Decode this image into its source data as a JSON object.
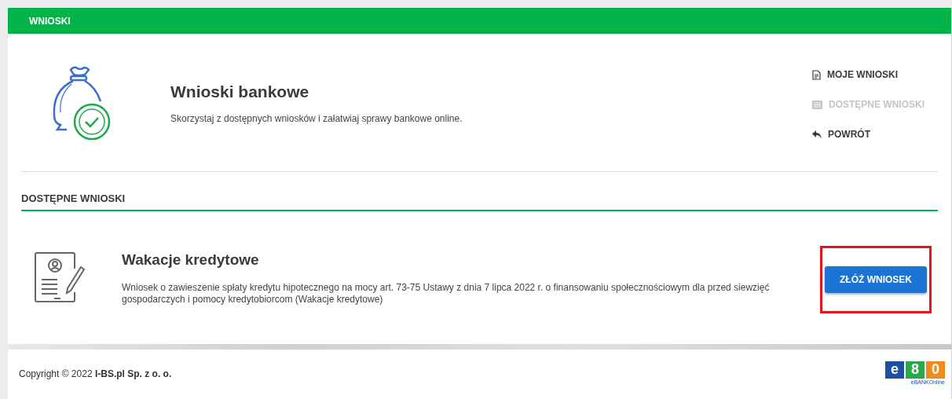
{
  "header": {
    "title": "WNIOSKI"
  },
  "intro": {
    "title": "Wnioski bankowe",
    "description": "Skorzystaj z dostępnych wniosków i załatwiaj sprawy bankowe online."
  },
  "nav": [
    {
      "kind": "document",
      "label": "MOJE WNIOSKI",
      "disabled": false
    },
    {
      "kind": "list",
      "label": "DOSTĘPNE WNIOSKI",
      "disabled": true
    },
    {
      "kind": "back",
      "label": "POWRÓT",
      "disabled": false
    }
  ],
  "section": {
    "title": "DOSTĘPNE WNIOSKI"
  },
  "applications": [
    {
      "title": "Wakacje kredytowe",
      "description": "Wniosek o zawieszenie spłaty kredytu hipotecznego na mocy art. 73-75 Ustawy z dnia 7 lipca 2022 r. o finansowaniu społecznościowym dla przed siewzięć gospodarczych i pomocy kredytobiorcom (Wakacje kredytowe)",
      "button": "ZŁÓŻ WNIOSEK",
      "highlighted": true
    }
  ],
  "footer": {
    "copyright": "Copyright © 2022 **I-BS.pl Sp. z o. o.**",
    "logo": {
      "letters": [
        "e",
        "8",
        "0"
      ],
      "caption": "eBANKOnline"
    }
  }
}
